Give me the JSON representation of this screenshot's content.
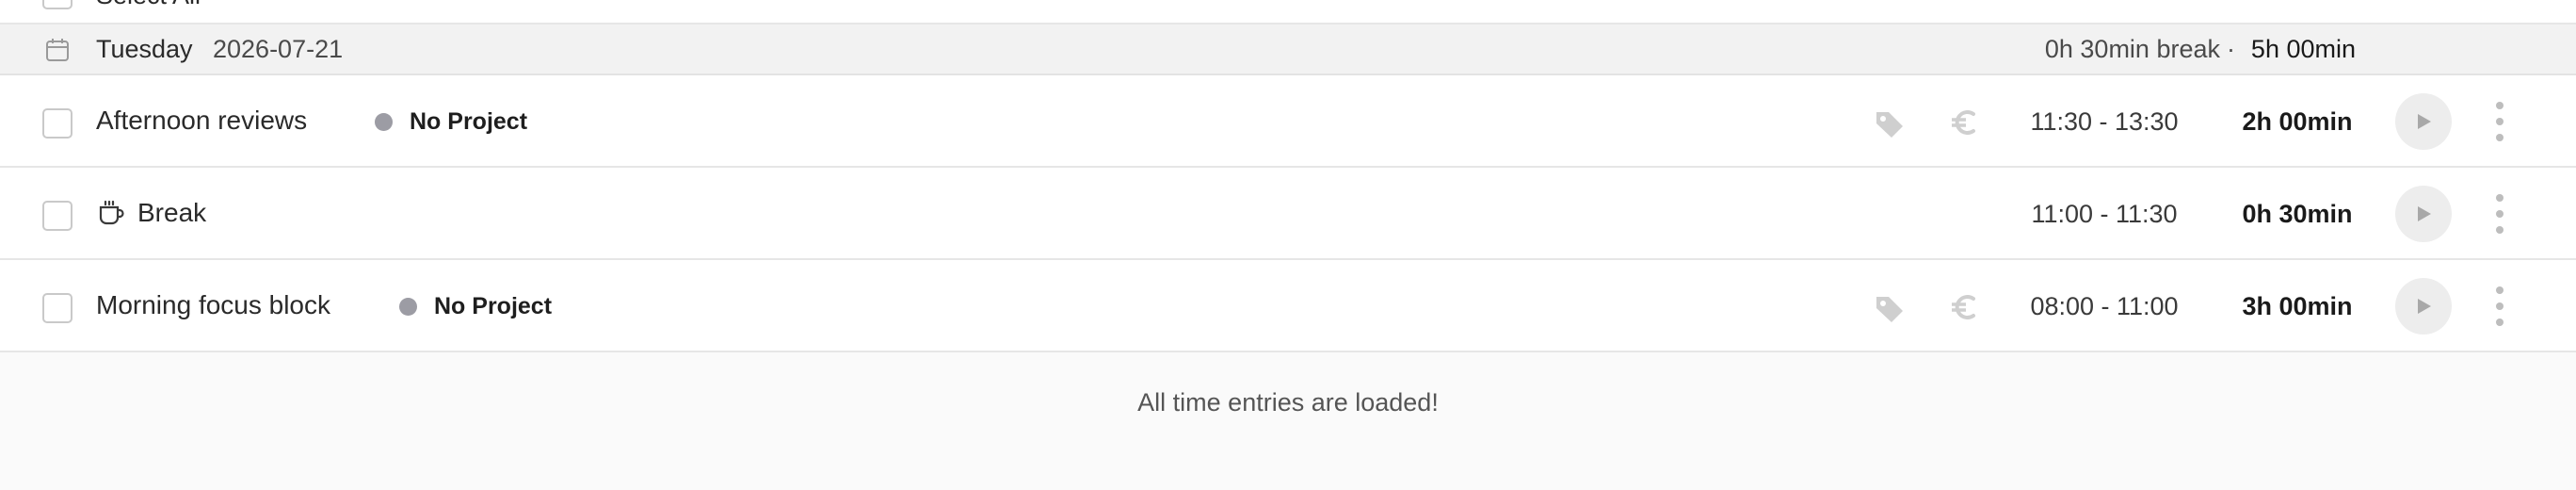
{
  "top_row": {
    "select_all_label": "Select All"
  },
  "day": {
    "weekday": "Tuesday",
    "date": "2026-07-21",
    "break_summary": "0h 30min break",
    "separator": "·",
    "total": "5h 00min"
  },
  "entries": [
    {
      "title": "Afternoon reviews",
      "project": "No Project",
      "time_range": "11:30 - 13:30",
      "duration": "2h 00min",
      "icons": [
        "tag-icon",
        "euro-icon",
        "play-icon",
        "more-vertical-icon"
      ]
    },
    {
      "title": "Break",
      "time_range": "11:00 - 11:30",
      "duration": "0h 30min",
      "icons": [
        "coffee-icon",
        "play-icon",
        "more-vertical-icon"
      ]
    },
    {
      "title": "Morning focus block",
      "project": "No Project",
      "time_range": "08:00 - 11:00",
      "duration": "3h 00min",
      "icons": [
        "tag-icon",
        "euro-icon",
        "play-icon",
        "more-vertical-icon"
      ]
    }
  ],
  "footer": {
    "message": "All time entries are loaded!"
  },
  "colors": {
    "project_dot": "#9c9ca4",
    "header_bg": "#f2f2f2",
    "play_bg": "#ededed",
    "icon_gray": "#cfcfcf"
  }
}
